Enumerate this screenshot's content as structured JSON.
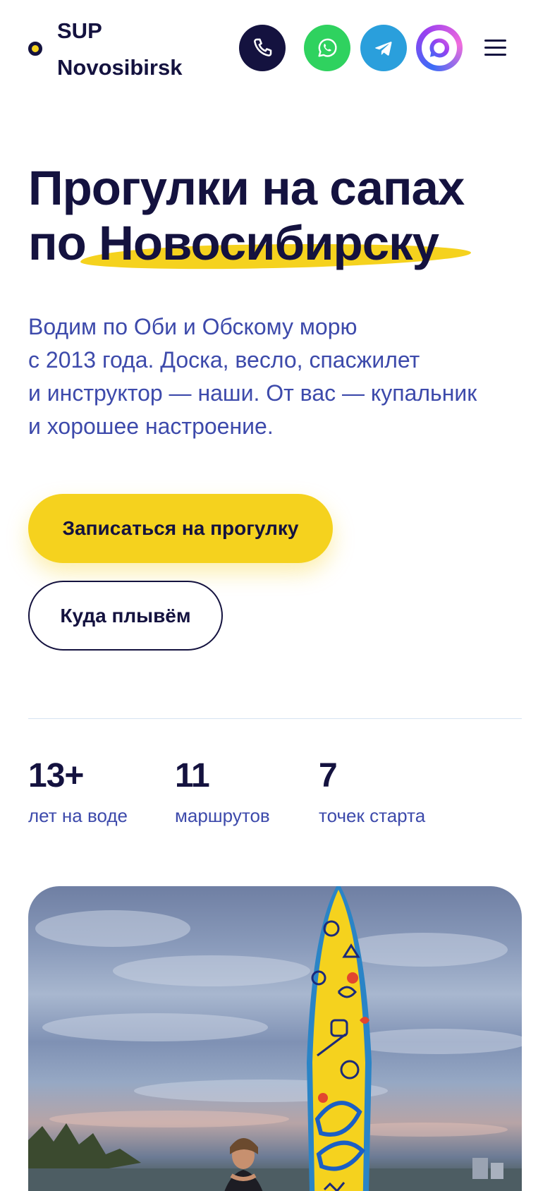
{
  "header": {
    "logo_line1": "SUP",
    "logo_line2": "Novosibirsk",
    "icons": [
      "phone-icon",
      "whatsapp-icon",
      "telegram-icon",
      "max-messenger-icon",
      "menu-icon"
    ]
  },
  "hero": {
    "title_line1": "Прогулки на сапах",
    "title_line2_prefix": "по",
    "title_line2_highlight": "Новосибирску",
    "subtitle_lines": [
      "Водим по Оби и Обскому морю",
      "с 2013 года. Доска, весло, спасжилет",
      "и инструктор — наши. От вас — купальник",
      "и хорошее настроение."
    ],
    "primary_button": "Записаться на прогулку",
    "secondary_button": "Куда плывём"
  },
  "stats": [
    {
      "value": "13+",
      "label": "лет на воде"
    },
    {
      "value": "11",
      "label": "маршрутов"
    },
    {
      "value": "7",
      "label": "точек старта"
    }
  ],
  "colors": {
    "navy": "#14123f",
    "accent_yellow": "#f5d21e",
    "text_blue": "#3d4aab",
    "whatsapp": "#2fd25f",
    "telegram": "#2a9fdc"
  }
}
